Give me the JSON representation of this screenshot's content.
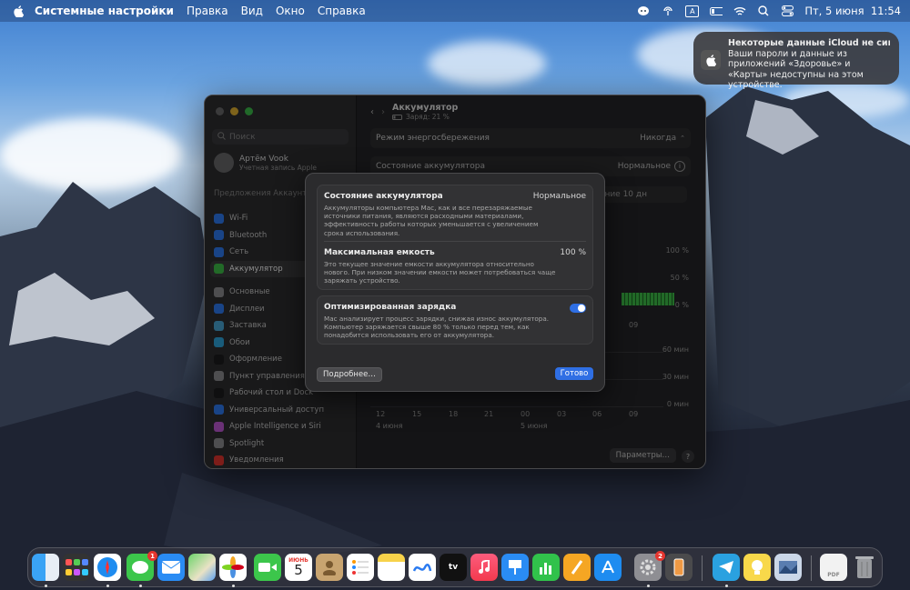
{
  "menubar": {
    "app_name": "Системные настройки",
    "items": [
      "Правка",
      "Вид",
      "Окно",
      "Справка"
    ],
    "keyboard_layout": "A",
    "clock": "Пт, 5 июня  11:54"
  },
  "notification": {
    "title": "Некоторые данные iCloud не синхрон…",
    "body": "Ваши пароли и данные из приложений «Здоровье» и «Карты» недоступны на этом устройстве."
  },
  "sidebar": {
    "search_placeholder": "Поиск",
    "user_name": "Артём Vook",
    "user_sub": "Учетная запись Apple",
    "section_title": "Предложения Аккаунта",
    "items": [
      {
        "label": "Wi-Fi",
        "color": "#2f7cf6"
      },
      {
        "label": "Bluetooth",
        "color": "#2f7cf6"
      },
      {
        "label": "Сеть",
        "color": "#2f7cf6"
      },
      {
        "label": "Аккумулятор",
        "color": "#3ec24a"
      },
      {
        "label": "Основные",
        "color": "#8e8e93"
      },
      {
        "label": "Дисплеи",
        "color": "#2f7cf6"
      },
      {
        "label": "Заставка",
        "color": "#4aa8d8"
      },
      {
        "label": "Обои",
        "color": "#2fa8e0"
      },
      {
        "label": "Оформление",
        "color": "#1c1c1e"
      },
      {
        "label": "Пункт управления",
        "color": "#8e8e93"
      },
      {
        "label": "Рабочий стол и Dock",
        "color": "#1c1c1e"
      },
      {
        "label": "Универсальный доступ",
        "color": "#2f7cf6"
      },
      {
        "label": "Apple Intelligence и Siri",
        "color": "#c15ad8"
      },
      {
        "label": "Spotlight",
        "color": "#8e8e93"
      },
      {
        "label": "Уведомления",
        "color": "#e5352f"
      }
    ]
  },
  "main": {
    "title": "Аккумулятор",
    "subtitle": "Заряд: 21 %",
    "low_power_label": "Режим энергосбережения",
    "low_power_value": "Никогда",
    "battery_health_label": "Состояние аккумулятора",
    "battery_health_value": "Нормальное",
    "period_label": "дние 10 дн",
    "pct_labels": [
      "100 %",
      "50 %",
      "0 %"
    ],
    "min_labels": [
      "60 мин",
      "30 мин",
      "0 мин"
    ],
    "hour_09": "09",
    "x_hours": [
      "12",
      "15",
      "18",
      "21",
      "00",
      "03",
      "06",
      "09"
    ],
    "date_left": "4 июня",
    "date_right": "5 июня",
    "params_button": "Параметры…",
    "help": "?"
  },
  "sheet": {
    "health_title": "Состояние аккумулятора",
    "health_value": "Нормальное",
    "health_desc": "Аккумуляторы компьютера Mac, как и все перезаряжаемые источники питания, являются расходными материалами, эффективность работы которых уменьшается с увеличением срока использования.",
    "capacity_title": "Максимальная емкость",
    "capacity_value": "100 %",
    "capacity_desc": "Это текущее значение емкости аккумулятора относительно нового. При низком значении емкости может потребоваться чаще заряжать устройство.",
    "optimized_title": "Оптимизированная зарядка",
    "optimized_desc": "Mac анализирует процесс зарядки, снижая износ аккумулятора. Компьютер заряжается свыше 80 % только перед тем, как понадобится использовать его от аккумулятора.",
    "optimized_on": true,
    "more_button": "Подробнее…",
    "done_button": "Готово"
  },
  "dock": {
    "calendar_month": "ИЮНЬ",
    "calendar_day": "5",
    "messages_badge": "1",
    "settings_badge": "2",
    "tv_label": "tv",
    "pdf_label": "PDF"
  }
}
